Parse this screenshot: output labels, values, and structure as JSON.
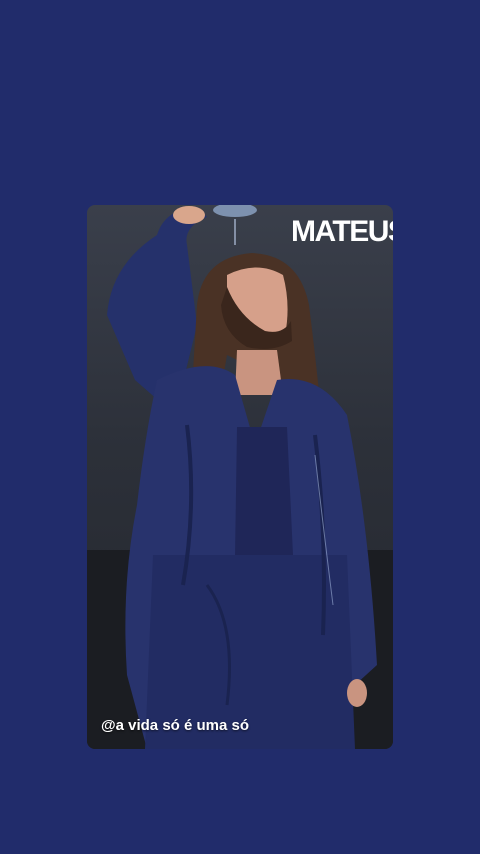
{
  "screen": {
    "background_color": "#212c6b"
  },
  "story": {
    "brand_text": "MATEUS",
    "caption": "@a vida só é uma só",
    "media_description_icon": "performer-photo"
  }
}
